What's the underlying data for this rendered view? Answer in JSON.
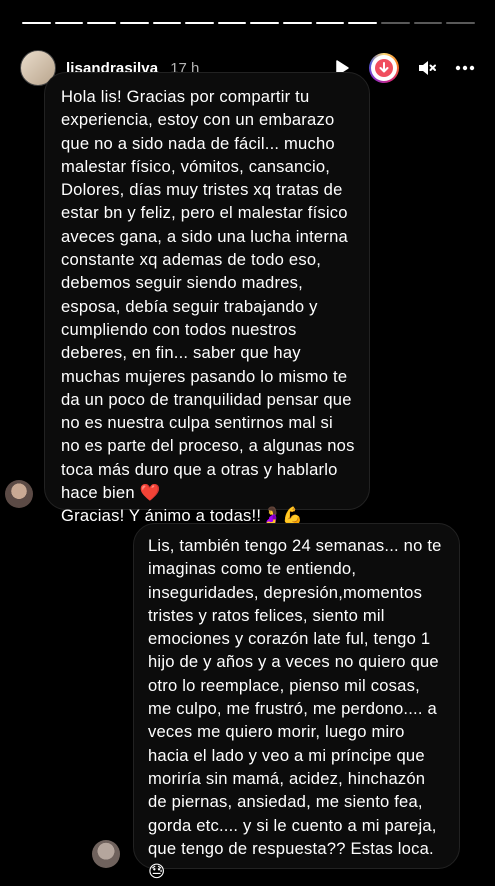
{
  "story": {
    "segments_total": 14,
    "segments_done": 11
  },
  "header": {
    "username": "lisandrasilva",
    "time": "17 h",
    "icons": [
      "play-icon",
      "download-icon",
      "mute-icon",
      "more-icon"
    ]
  },
  "messages": [
    {
      "text": "Hola lis! Gracias por compartir tu\nexperiencia, estoy con un embarazo\nque no a sido nada de fácil... mucho\nmalestar físico, vómitos, cansancio,\nDolores, días muy tristes xq tratas de\nestar bn y feliz, pero el malestar físico\naveces gana, a sido una lucha interna\nconstante xq ademas de todo eso,\ndebemos seguir siendo madres,\nesposa, debía seguir trabajando y\ncumpliendo con todos nuestros\ndeberes, en fin... saber que hay\nmuchas mujeres pasando lo mismo  te\nda un poco de tranquilidad pensar que\nno es nuestra culpa sentirnos mal si\nno es parte del proceso, a algunas nos\ntoca más duro que a otras y hablarlo\nhace bien ❤️\nGracias! Y ánimo a todas!!🤰💪"
    },
    {
      "text": "Lis, también tengo 24 semanas... no te\nimaginas como  te entiendo,\ninseguridades, depresión,momentos\ntristes y ratos felices, siento mil\nemociones y corazón late ful, tengo 1\nhijo de y años y a veces no quiero que\notro lo reemplace, pienso mil cosas,\nme culpo, me frustró, me perdono.... a\nveces me quiero morir, luego miro\nhacia el lado y veo a mi príncipe que\nmoriría sin mamá, acidez, hinchazón\nde piernas, ansiedad, me siento fea,\ngorda etc.... y si le cuento a mi pareja,\nque tengo de respuesta?? Estas loca.\n😓"
    }
  ]
}
